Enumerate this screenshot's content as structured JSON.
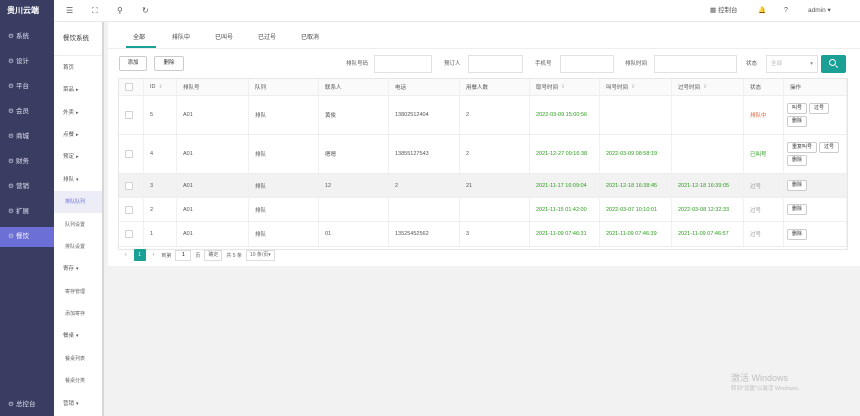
{
  "brand": "贵川云端",
  "sidebar": [
    {
      "label": "系统",
      "icon": "gear-icon",
      "glyph": "⚙"
    },
    {
      "label": "设计",
      "icon": "gear-icon",
      "glyph": "⚙"
    },
    {
      "label": "平台",
      "icon": "gear-icon",
      "glyph": "⚙"
    },
    {
      "label": "会员",
      "icon": "gear-icon",
      "glyph": "⚙"
    },
    {
      "label": "商城",
      "icon": "gear-icon",
      "glyph": "⚙"
    },
    {
      "label": "财务",
      "icon": "gear-icon",
      "glyph": "⚙"
    },
    {
      "label": "营销",
      "icon": "gear-icon",
      "glyph": "⚙"
    },
    {
      "label": "扩展",
      "icon": "gear-icon",
      "glyph": "⚙"
    },
    {
      "label": "餐饮",
      "icon": "gear-icon",
      "glyph": "⚙",
      "active": true
    },
    {
      "label": "总控台",
      "icon": "gear-icon",
      "glyph": "⚙"
    }
  ],
  "subnav": {
    "title": "餐饮系统",
    "items": [
      {
        "label": "首页",
        "type": "top"
      },
      {
        "label": "菜品",
        "type": "group",
        "arrow": "▸"
      },
      {
        "label": "外卖",
        "type": "group",
        "arrow": "▸"
      },
      {
        "label": "点餐",
        "type": "group",
        "arrow": "▸"
      },
      {
        "label": "预定",
        "type": "group",
        "arrow": "▸"
      },
      {
        "label": "排队",
        "type": "group",
        "arrow": "▾"
      },
      {
        "label": "排队队列",
        "type": "child",
        "selected": true
      },
      {
        "label": "队列设置",
        "type": "child"
      },
      {
        "label": "排队设置",
        "type": "child"
      },
      {
        "label": "寄存",
        "type": "group",
        "arrow": "▾"
      },
      {
        "label": "寄存管理",
        "type": "child"
      },
      {
        "label": "添加寄存",
        "type": "child"
      },
      {
        "label": "餐桌",
        "type": "group",
        "arrow": "▾"
      },
      {
        "label": "餐桌列表",
        "type": "child"
      },
      {
        "label": "餐桌分类",
        "type": "child"
      },
      {
        "label": "营销",
        "type": "group",
        "arrow": "▾"
      }
    ]
  },
  "header": {
    "menu_glyph": "☰",
    "fullscreen_glyph": "⛶",
    "link_glyph": "⚲",
    "refresh_glyph": "↻",
    "console_glyph": "▦",
    "console": "控制台",
    "bell_glyph": "🔔",
    "help_glyph": "?",
    "user": "admin",
    "user_caret": "▾"
  },
  "tabs": [
    "全部",
    "排队中",
    "已叫号",
    "已过号",
    "已取消"
  ],
  "toolbar": {
    "add": "添加",
    "delete": "删除",
    "queue_no_label": "排队号码",
    "reserver_label": "预订人",
    "phone_label": "手机号",
    "queue_time_label": "排队时间",
    "status_label": "状态",
    "status_placeholder": "全部",
    "status_caret": "▾"
  },
  "table": {
    "columns": [
      "",
      "ID",
      "排队号",
      "队列",
      "联系人",
      "电话",
      "用餐人数",
      "取号时间",
      "叫号时间",
      "过号时间",
      "状态",
      "操作"
    ],
    "sort_glyph": "⇕",
    "rows": [
      {
        "id": "5",
        "queue_no": "A01",
        "queue": "排队",
        "contact": "黄俊",
        "phone": "13802512404",
        "diners": "2",
        "take_time": "2022-03-09 15:00:56",
        "call_time": "",
        "pass_time": "",
        "status": "排队中",
        "status_class": "red",
        "ops": [
          "叫号",
          "过号",
          "删除"
        ]
      },
      {
        "id": "4",
        "queue_no": "A01",
        "queue": "排队",
        "contact": "嗯嗯",
        "phone": "13855127543",
        "diners": "2",
        "take_time": "2021-12-27 09:16:38",
        "call_time": "2022-03-09 08:58:19",
        "pass_time": "",
        "status": "已叫号",
        "status_class": "green",
        "ops": [
          "重复叫号",
          "过号",
          "删除"
        ]
      },
      {
        "id": "3",
        "queue_no": "A01",
        "queue": "排队",
        "contact": "12",
        "phone": "2",
        "diners": "21",
        "take_time": "2021-11-17 16:09:04",
        "call_time": "2021-12-18 16:38:45",
        "pass_time": "2021-12-18 16:39:05",
        "status": "过号",
        "status_class": "gray",
        "ops": [
          "删除"
        ]
      },
      {
        "id": "2",
        "queue_no": "A01",
        "queue": "排队",
        "contact": "",
        "phone": "",
        "diners": "",
        "take_time": "2021-11-15 01:42:00",
        "call_time": "2022-03-07 10:10:01",
        "pass_time": "2022-03-08 12:32:33",
        "status": "过号",
        "status_class": "gray",
        "ops": [
          "删除"
        ]
      },
      {
        "id": "1",
        "queue_no": "A01",
        "queue": "排队",
        "contact": "01",
        "phone": "13525452562",
        "diners": "3",
        "take_time": "2021-11-09 07:46:31",
        "call_time": "2021-11-09 07:46:39",
        "pass_time": "2021-11-09 07:46:57",
        "status": "过号",
        "status_class": "gray",
        "ops": [
          "删除"
        ]
      }
    ]
  },
  "pager": {
    "prev": "‹",
    "current": "1",
    "next": "›",
    "goto_label": "到第",
    "goto_value": "1",
    "page_unit": "页",
    "confirm": "确定",
    "total": "共 5 条",
    "page_size": "10 条/页",
    "page_size_caret": "▾"
  },
  "watermark": {
    "line1": "激活 Windows",
    "line2": "转到\"设置\"以激活 Windows。"
  }
}
